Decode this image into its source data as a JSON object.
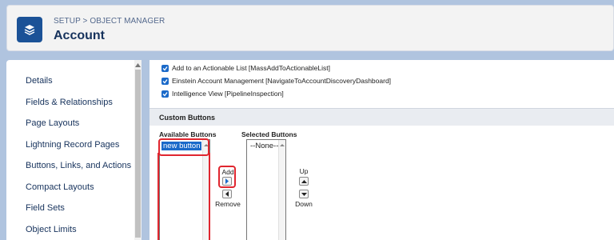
{
  "header": {
    "breadcrumb": "SETUP > OBJECT MANAGER",
    "title": "Account",
    "icon": "layers-icon"
  },
  "sidebar": {
    "items": [
      {
        "label": "Details"
      },
      {
        "label": "Fields & Relationships"
      },
      {
        "label": "Page Layouts"
      },
      {
        "label": "Lightning Record Pages"
      },
      {
        "label": "Buttons, Links, and Actions"
      },
      {
        "label": "Compact Layouts"
      },
      {
        "label": "Field Sets"
      },
      {
        "label": "Object Limits"
      }
    ]
  },
  "checkboxes": [
    {
      "label": "Add to an Actionable List [MassAddToActionableList]",
      "checked": true
    },
    {
      "label": "Einstein Account Management [NavigateToAccountDiscoveryDashboard]",
      "checked": true
    },
    {
      "label": "Intelligence View [PipelineInspection]",
      "checked": true
    }
  ],
  "custom_buttons": {
    "section_title": "Custom Buttons",
    "available_label": "Available Buttons",
    "available_options": [
      "new button"
    ],
    "selected_label": "Selected Buttons",
    "selected_options": [
      "--None--"
    ],
    "add_label": "Add",
    "remove_label": "Remove",
    "up_label": "Up",
    "down_label": "Down"
  },
  "colors": {
    "brand": "#1b5297",
    "accent": "#1b6ac9",
    "highlight": "#e0262f",
    "background": "#b0c4df"
  }
}
